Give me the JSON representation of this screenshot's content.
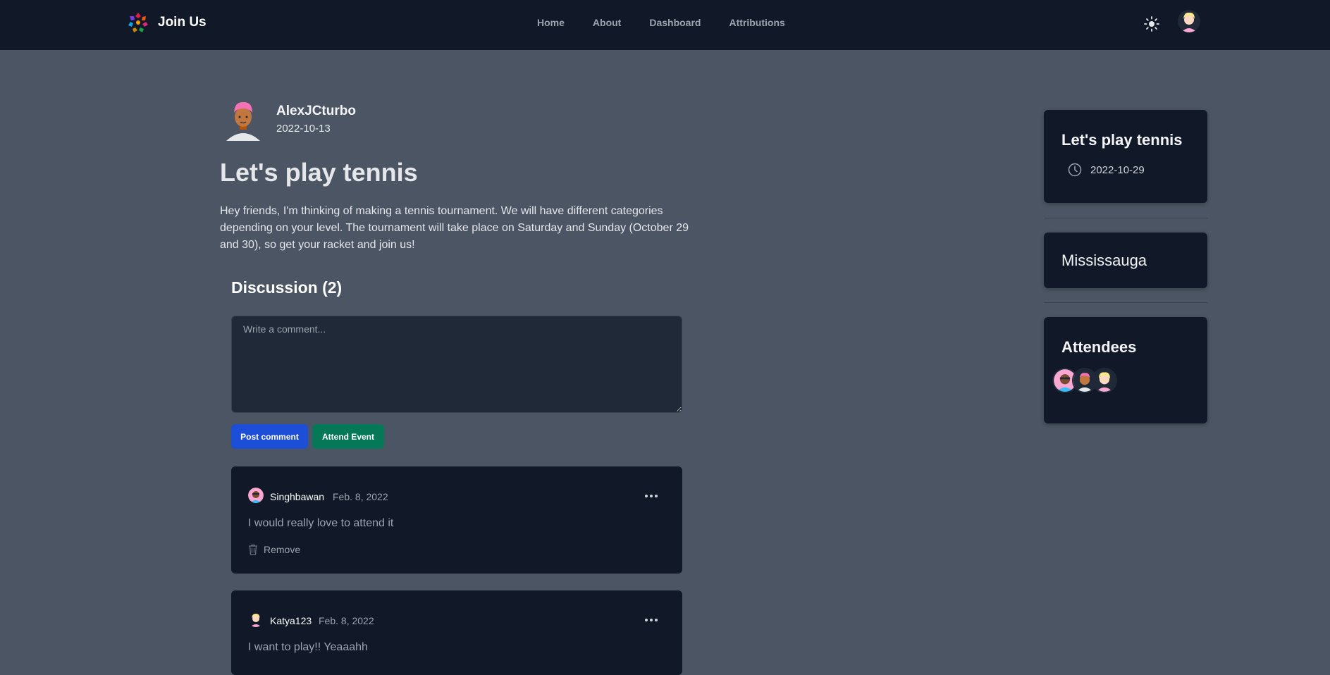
{
  "app": {
    "name": "Join Us"
  },
  "nav": {
    "links": [
      "Home",
      "About",
      "Dashboard",
      "Attributions"
    ]
  },
  "post": {
    "author": "AlexJCturbo",
    "date": "2022-10-13",
    "title": "Let's play tennis",
    "body": "Hey friends, I'm thinking of making a tennis tournament. We will have different categories depending on your level. The tournament will take place on Saturday and Sunday (October 29 and 30), so get your racket and join us!"
  },
  "discussion": {
    "title": "Discussion (2)",
    "placeholder": "Write a comment...",
    "post_button": "Post comment",
    "attend_button": "Attend Event"
  },
  "comments": [
    {
      "user": "Singhbawan",
      "date": "Feb. 8, 2022",
      "text": "I would really love to attend it",
      "remove_label": "Remove"
    },
    {
      "user": "Katya123",
      "date": "Feb. 8, 2022",
      "text": "I want to play!! Yeaaahh"
    }
  ],
  "sidebar": {
    "event_title": "Let's play tennis",
    "event_date": "2022-10-29",
    "location": "Mississauga",
    "attendees_title": "Attendees"
  },
  "colors": {
    "navbar_bg": "#111827",
    "page_bg": "#4b5563",
    "card_bg": "#111827",
    "post_button": "#1d4ed8",
    "attend_button": "#047857"
  },
  "icons": [
    "brand-logo-icon",
    "sun-icon",
    "clock-icon",
    "trash-icon",
    "more-dots-icon"
  ]
}
